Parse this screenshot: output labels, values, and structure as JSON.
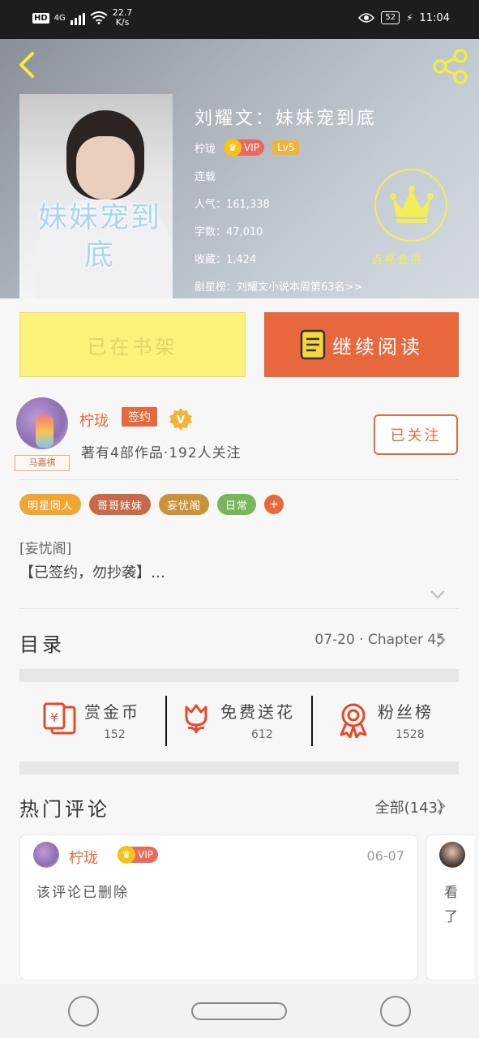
{
  "status_bar": {
    "network": "4G",
    "speed_value": "22.7",
    "speed_unit": "K/s",
    "battery": "52",
    "time": "11:04"
  },
  "book": {
    "cover_title": "妹妹宠到底",
    "title": "刘耀文：妹妹宠到底",
    "author_line_name": "柠珑",
    "vip_label": "VIP",
    "level": "Lv5",
    "status": "连载",
    "popularity": "人气：161,338",
    "word_count": "字数：47,010",
    "favorites": "收藏：1,424",
    "rank": "剧星榜：刘耀文小说本周第63名>>",
    "member_badge": "点亮会员"
  },
  "actions": {
    "added_label": "已在书架",
    "read_label": "继续阅读"
  },
  "author": {
    "avatar_tag": "马嘉祺",
    "name": "柠珑",
    "signed_label": "签约",
    "v_label": "V",
    "stats": "著有4部作品·192人关注",
    "follow_label": "已关注"
  },
  "tags": [
    {
      "label": "明星同人",
      "color": "#f0a632"
    },
    {
      "label": "哥哥妹妹",
      "color": "#c66a4a"
    },
    {
      "label": "妄忧阁",
      "color": "#c9933a"
    },
    {
      "label": "日常",
      "color": "#79b55a"
    }
  ],
  "tag_add_label": "+",
  "description": {
    "line1": "[妄忧阁]",
    "line2": "【已签约，勿抄袭】…"
  },
  "toc": {
    "title": "目录",
    "latest": "07-20 · Chapter 45"
  },
  "stats": [
    {
      "label": "赏金币",
      "value": "152"
    },
    {
      "label": "免费送花",
      "value": "612"
    },
    {
      "label": "粉丝榜",
      "value": "1528"
    }
  ],
  "comments": {
    "title": "热门评论",
    "all_label": "全部(143)",
    "items": [
      {
        "name": "柠珑",
        "vip": "VIP",
        "date": "06-07",
        "text": "该评论已删除"
      },
      {
        "text": "看了"
      }
    ]
  },
  "colors": {
    "accent": "#e8683d",
    "yellow": "#fcf27a",
    "badge_yellow": "#f3ee55"
  }
}
